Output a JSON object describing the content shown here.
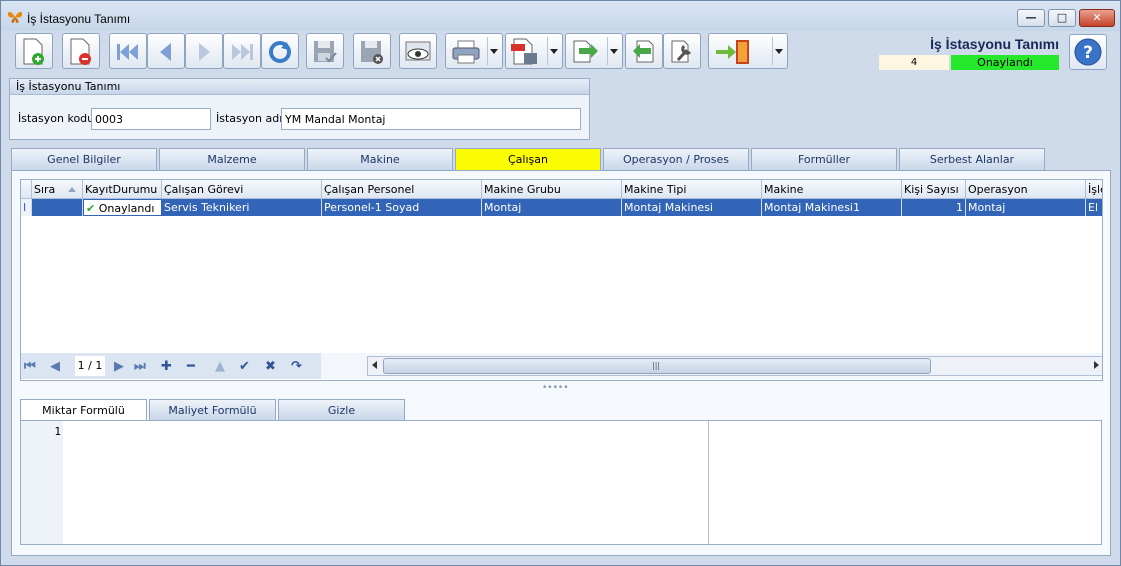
{
  "window": {
    "title": "İş İstasyonu Tanımı",
    "minimize": "—",
    "maximize": "□",
    "close": "✕"
  },
  "toolbar": {
    "buttons": [
      {
        "name": "new-record-button",
        "icon": "page-add-icon"
      },
      {
        "name": "delete-record-button",
        "icon": "page-delete-icon"
      },
      {
        "name": "first-record-button",
        "icon": "first-icon"
      },
      {
        "name": "previous-record-button",
        "icon": "previous-icon"
      },
      {
        "name": "next-record-button",
        "icon": "next-icon"
      },
      {
        "name": "last-record-button",
        "icon": "last-icon"
      },
      {
        "name": "refresh-button",
        "icon": "refresh-icon"
      },
      {
        "name": "save-button",
        "icon": "save-icon"
      },
      {
        "name": "save-cancel-button",
        "icon": "save-cancel-icon"
      },
      {
        "name": "preview-button",
        "icon": "preview-eye-icon"
      },
      {
        "name": "print-button",
        "icon": "printer-icon"
      },
      {
        "name": "pdf-export-button",
        "icon": "pdf-icon"
      },
      {
        "name": "export-button",
        "icon": "export-icon"
      },
      {
        "name": "import-button",
        "icon": "import-icon"
      },
      {
        "name": "tools-button",
        "icon": "wrench-icon"
      },
      {
        "name": "exit-button",
        "icon": "exit-door-icon"
      }
    ]
  },
  "header": {
    "form_title": "İş İstasyonu Tanımı",
    "record_count": "4",
    "status": "Onaylandı",
    "status_color": "#25e82a"
  },
  "group": {
    "title": "İş İstasyonu Tanımı",
    "code_label": "İstasyon kodu",
    "code_value": "0003",
    "name_label": "İstasyon adı",
    "name_value": "YM Mandal Montaj"
  },
  "tabs": [
    "Genel Bilgiler",
    "Malzeme",
    "Makine",
    "Çalışan",
    "Operasyon / Proses",
    "Formüller",
    "Serbest Alanlar"
  ],
  "active_tab": "Çalışan",
  "active_tab_color": "#fbfb04",
  "grid": {
    "columns": [
      "Sıra",
      "KayıtDurumu",
      "Çalışan Görevi",
      "Çalışan Personel",
      "Makine Grubu",
      "Makine Tipi",
      "Makine",
      "Kişi Sayısı",
      "Operasyon",
      "İşle"
    ],
    "rows": [
      {
        "sira": "",
        "kayit_durumu": "Onaylandı",
        "gorev": "Servis Teknikeri",
        "personel": "Personel-1 Soyad",
        "makine_grubu": "Montaj",
        "makine_tipi": "Montaj Makinesi",
        "makine": "Montaj Makinesi1",
        "kisi_sayisi": "1",
        "operasyon": "Montaj",
        "isle": "El i"
      }
    ],
    "navigator_position": "1 / 1",
    "scroll_grip": "|||"
  },
  "subtabs": [
    "Miktar Formülü",
    "Maliyet Formülü",
    "Gizle"
  ],
  "editor": {
    "line_number": "1"
  }
}
